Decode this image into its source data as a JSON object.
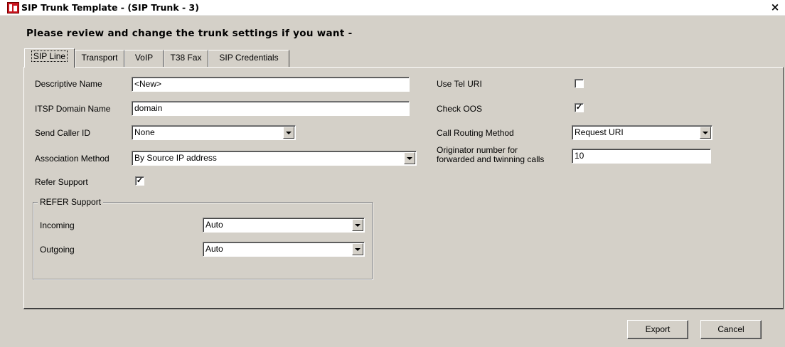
{
  "window": {
    "title": "SIP Trunk Template - (SIP Trunk - 3)",
    "close_glyph": "×"
  },
  "heading": "Please review and change the trunk settings if you want -",
  "tabs": [
    {
      "label": "SIP Line",
      "active": true
    },
    {
      "label": "Transport",
      "active": false
    },
    {
      "label": "VoIP",
      "active": false
    },
    {
      "label": "T38 Fax",
      "active": false
    },
    {
      "label": "SIP Credentials",
      "active": false
    }
  ],
  "sip_line": {
    "descriptive_name": {
      "label": "Descriptive Name",
      "value": "<New>"
    },
    "itsp_domain_name": {
      "label": "ITSP Domain Name",
      "value": "domain"
    },
    "send_caller_id": {
      "label": "Send Caller ID",
      "value": "None"
    },
    "association_method": {
      "label": "Association Method",
      "value": "By Source IP address"
    },
    "refer_support": {
      "label": "Refer Support",
      "checked": true,
      "check_glyph": "✓"
    },
    "refer_group": {
      "title": "REFER Support",
      "incoming": {
        "label": "Incoming",
        "value": "Auto"
      },
      "outgoing": {
        "label": "Outgoing",
        "value": "Auto"
      }
    },
    "use_tel_uri": {
      "label": "Use Tel URI",
      "checked": false,
      "check_glyph": ""
    },
    "check_oos": {
      "label": "Check OOS",
      "checked": true,
      "check_glyph": "✓"
    },
    "call_routing_method": {
      "label": "Call Routing Method",
      "value": "Request URI"
    },
    "originator_number": {
      "label_line1": "Originator number for",
      "label_line2": "forwarded and twinning calls",
      "value": "10"
    }
  },
  "buttons": {
    "export": "Export",
    "cancel": "Cancel"
  },
  "colors": {
    "dialog_background": "#d4d0c8",
    "icon_red": "#c8141e"
  }
}
